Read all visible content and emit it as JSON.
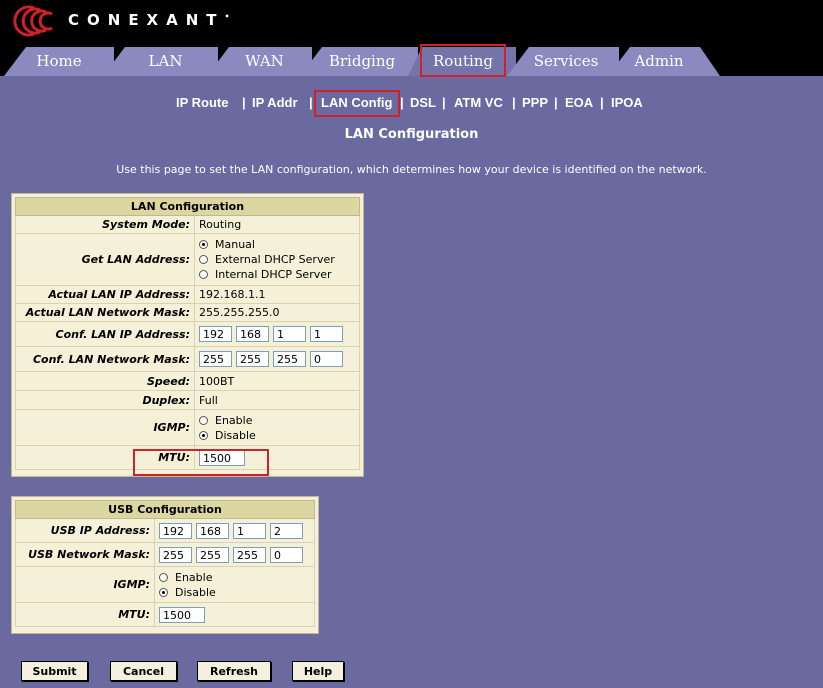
{
  "brand": {
    "name": "CONEXANT",
    "tm": "•"
  },
  "tabs": [
    {
      "label": "Home"
    },
    {
      "label": "LAN"
    },
    {
      "label": "WAN"
    },
    {
      "label": "Bridging"
    },
    {
      "label": "Routing",
      "active": true
    },
    {
      "label": "Services"
    },
    {
      "label": "Admin"
    }
  ],
  "subnav": [
    {
      "label": "IP Route"
    },
    {
      "label": "IP Addr"
    },
    {
      "label": "LAN Config",
      "active": true
    },
    {
      "label": "DSL"
    },
    {
      "label": "ATM VC"
    },
    {
      "label": "PPP"
    },
    {
      "label": "EOA"
    },
    {
      "label": "IPOA"
    }
  ],
  "subnav_separator": "|",
  "page": {
    "title": "LAN Configuration",
    "description": "Use this page to set the LAN configuration, which determines how your device is identified on the network."
  },
  "lan": {
    "header": "LAN Configuration",
    "system_mode_label": "System Mode:",
    "system_mode_value": "Routing",
    "get_lan_label": "Get LAN Address:",
    "get_lan_options": [
      "Manual",
      "External DHCP Server",
      "Internal DHCP Server"
    ],
    "get_lan_selected": "Manual",
    "actual_ip_label": "Actual LAN IP Address:",
    "actual_ip_value": "192.168.1.1",
    "actual_mask_label": "Actual LAN Network Mask:",
    "actual_mask_value": "255.255.255.0",
    "conf_ip_label": "Conf. LAN IP Address:",
    "conf_ip": [
      "192",
      "168",
      "1",
      "1"
    ],
    "conf_mask_label": "Conf. LAN Network Mask:",
    "conf_mask": [
      "255",
      "255",
      "255",
      "0"
    ],
    "speed_label": "Speed:",
    "speed_value": "100BT",
    "duplex_label": "Duplex:",
    "duplex_value": "Full",
    "igmp_label": "IGMP:",
    "igmp_options": [
      "Enable",
      "Disable"
    ],
    "igmp_selected": "Disable",
    "mtu_label": "MTU:",
    "mtu_value": "1500"
  },
  "usb": {
    "header": "USB Configuration",
    "ip_label": "USB IP Address:",
    "ip": [
      "192",
      "168",
      "1",
      "2"
    ],
    "mask_label": "USB Network Mask:",
    "mask": [
      "255",
      "255",
      "255",
      "0"
    ],
    "igmp_label": "IGMP:",
    "igmp_options": [
      "Enable",
      "Disable"
    ],
    "igmp_selected": "Disable",
    "mtu_label": "MTU:",
    "mtu_value": "1500"
  },
  "buttons": {
    "submit": "Submit",
    "cancel": "Cancel",
    "refresh": "Refresh",
    "help": "Help"
  },
  "colors": {
    "background": "#6a6aa0",
    "tab": "#8a8ac0",
    "panel": "#f5f1d8",
    "panel_header": "#dcd6a0",
    "highlight": "#d0202a"
  }
}
